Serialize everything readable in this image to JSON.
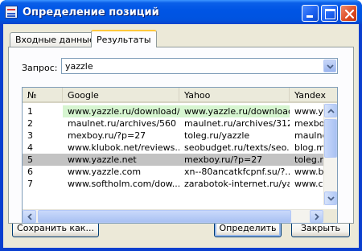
{
  "window": {
    "title": "Определение позиций"
  },
  "tabs": [
    {
      "label": "Входные данные",
      "active": false
    },
    {
      "label": "Результаты",
      "active": true
    }
  ],
  "query": {
    "label": "Запрос:",
    "value": "yazzle"
  },
  "table": {
    "columns": [
      "№",
      "Google",
      "Yahoo",
      "Yandex"
    ],
    "rows": [
      {
        "num": "1",
        "google": "www.yazzle.ru/download/",
        "yahoo": "www.yazzle.ru/download/",
        "yandex": "www.y",
        "highlight": "match"
      },
      {
        "num": "2",
        "google": "maulnet.ru/archives/560",
        "yahoo": "maulnet.ru/archives/312",
        "yandex": "mexbo",
        "highlight": "none"
      },
      {
        "num": "3",
        "google": "mexboy.ru/?p=27",
        "yahoo": "toleg.ru/yazzle",
        "yandex": "maulne",
        "highlight": "none"
      },
      {
        "num": "4",
        "google": "www.klubok.net/reviews...",
        "yahoo": "seobudget.ru/texts/seo...",
        "yandex": "blog.m",
        "highlight": "none"
      },
      {
        "num": "5",
        "google": "www.yazzle.net",
        "yahoo": "mexboy.ru/?p=27",
        "yandex": "toleg.r",
        "highlight": "selected"
      },
      {
        "num": "6",
        "google": "www.yazzle.com",
        "yahoo": "xn--80ancatkfcpnf.su/?...",
        "yandex": "www.b",
        "highlight": "none"
      },
      {
        "num": "7",
        "google": "www.softholm.com/dow...",
        "yahoo": "zarabotok-internet.ru/ya...",
        "yandex": "www.c",
        "highlight": "none"
      }
    ]
  },
  "buttons": {
    "save": "Сохранить как...",
    "detect": "Определить",
    "close": "Закрыть"
  },
  "colors": {
    "title_bar": "#0055e5",
    "match_row": "#d6f5d0",
    "selected_row": "#c3c3c3"
  },
  "icons": {
    "app": "app-list-icon",
    "minimize": "minimize-icon",
    "maximize": "maximize-icon",
    "close": "close-icon",
    "combo_arrow": "chevron-down-icon"
  }
}
